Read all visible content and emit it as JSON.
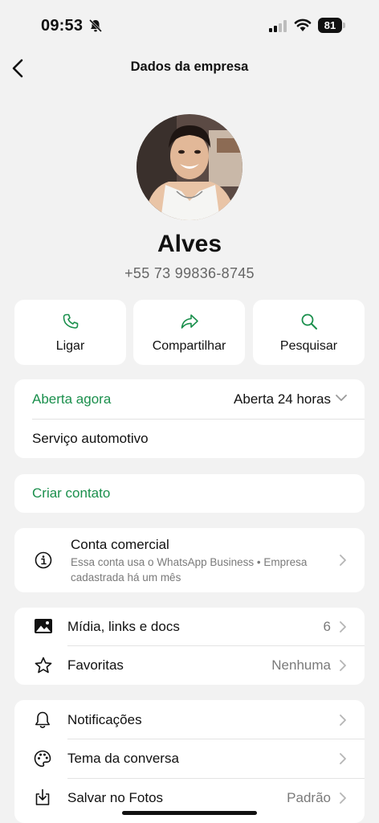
{
  "status_bar": {
    "time": "09:53",
    "battery": "81"
  },
  "nav": {
    "title": "Dados da empresa"
  },
  "profile": {
    "name": "Alves",
    "phone": "+55 73 99836-8745"
  },
  "actions": [
    {
      "label": "Ligar",
      "icon": "phone-icon"
    },
    {
      "label": "Compartilhar",
      "icon": "share-icon"
    },
    {
      "label": "Pesquisar",
      "icon": "search-icon"
    }
  ],
  "hours": {
    "status": "Aberta agora",
    "value": "Aberta 24 horas",
    "category": "Serviço automotivo"
  },
  "create_contact": {
    "label": "Criar contato"
  },
  "business": {
    "title": "Conta comercial",
    "subtitle_line1": "Essa conta usa o WhatsApp Business • Empresa",
    "subtitle_line2": "cadastrada há um mês"
  },
  "media": {
    "media_label": "Mídia, links e docs",
    "media_count": "6",
    "favorites_label": "Favoritas",
    "favorites_value": "Nenhuma"
  },
  "settings": {
    "notifications_label": "Notificações",
    "theme_label": "Tema da conversa",
    "save_label": "Salvar no Fotos",
    "save_value": "Padrão"
  },
  "colors": {
    "accent": "#1a8f4c",
    "background": "#f2f2f2",
    "card": "#ffffff"
  }
}
